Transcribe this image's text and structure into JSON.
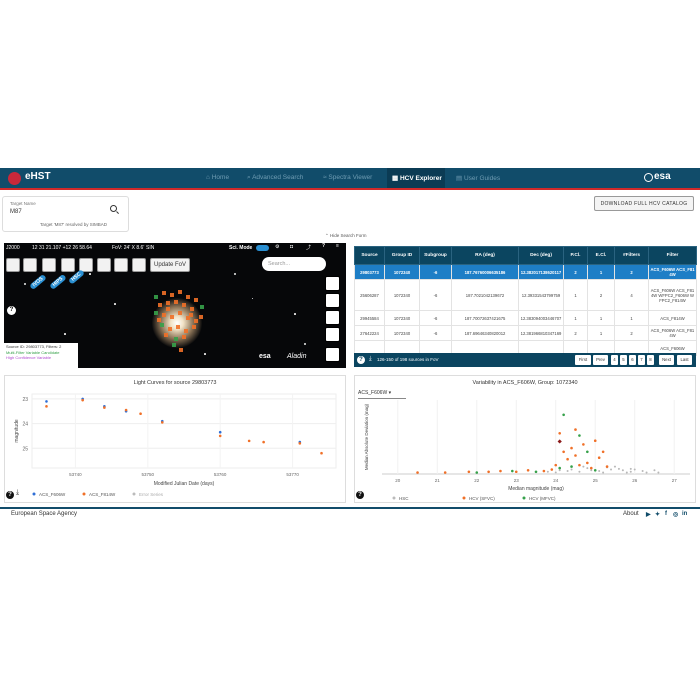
{
  "header": {
    "app_name": "eHST",
    "nav": [
      {
        "label": "Home",
        "icon": "home-icon"
      },
      {
        "label": "Advanced Search",
        "icon": "search-icon"
      },
      {
        "label": "Spectra Viewer",
        "icon": "spectra-icon"
      },
      {
        "label": "HCV Explorer",
        "icon": "grid-icon"
      },
      {
        "label": "User Guides",
        "icon": "doc-icon"
      }
    ],
    "active_nav": "HCV Explorer",
    "brand": "esa",
    "accent_color": "#d12a2a",
    "bar_color": "#114c6a"
  },
  "search": {
    "label": "Target Name",
    "value": "M87",
    "resolved": "Target 'M87' resolved by SIMBAD"
  },
  "download_button": "DOWNLOAD FULL HCV CATALOG",
  "hide_form": "Hide Search Form",
  "sky": {
    "frame": "J2000",
    "coords": "12 31 21.107 +12 26 58.64",
    "fov": "FoV: 24' X 8.6'",
    "projection": "SIN",
    "sci_mode": "Sci. Mode",
    "update_fov": "Update FoV",
    "search_placeholder": "Search...",
    "pills": [
      "IVOS",
      "HIPS",
      "HSC"
    ],
    "source_info": "Source ID: 29803773, Filters: 2",
    "legend_multi": "Multi-Filter Variable Candidate",
    "legend_high": "High Confidence Variable",
    "brand_esa": "esa",
    "brand_aladin": "Aladin"
  },
  "table": {
    "columns": [
      "Source",
      "Group ID",
      "Subgroup",
      "RA (deg)",
      "Dec (deg)",
      "P.Cl.",
      "E.Cl.",
      "#Filters",
      "Filter"
    ],
    "rows": [
      [
        "29803773",
        "1072340",
        "-6",
        "187.76760006635186",
        "12.382017138620117",
        "2",
        "1",
        "2",
        "ACS_F606W ACS_F814W"
      ],
      [
        "25606287",
        "1072340",
        "-6",
        "187.7021042139672",
        "12.39331543799759",
        "1",
        "2",
        "4",
        "ACS_F606W ACS_F814W WFPC2_F606W WFPC2_F814W"
      ],
      [
        "29945584",
        "1072340",
        "-6",
        "187.70072637421675",
        "12.383094003446707",
        "1",
        "1",
        "1",
        "ACS_F814W"
      ],
      [
        "27642224",
        "1072340",
        "-6",
        "187.69646340820012",
        "12.381966810347169",
        "2",
        "1",
        "2",
        "ACS_F606W ACS_F814W"
      ],
      [
        "",
        "",
        "",
        "",
        "",
        "",
        "",
        "",
        "ACS_F606W"
      ]
    ],
    "footer": "126-150 of 198 sources in FoV",
    "pages": [
      "First",
      "Prev",
      "4",
      "5",
      "6",
      "7",
      "8",
      "Next",
      "Last"
    ]
  },
  "lightcurve": {
    "title": "Light Curves for source 29803773",
    "legend": [
      "ACS_F606W",
      "ACS_F814W",
      "Error Series"
    ]
  },
  "variability": {
    "title": "Variability in ACS_F606W, Group: 1072340",
    "filter_select": "ACS_F606W",
    "legend": [
      "HSC",
      "HCV (SFVC)",
      "HCV (MFVC)"
    ]
  },
  "footer": {
    "org": "European Space Agency",
    "about": "About"
  },
  "chart_data": [
    {
      "type": "scatter",
      "title": "Light Curves for source 29803773",
      "xlabel": "Modified Julian Date (days)",
      "ylabel": "magnitude",
      "x_ticks": [
        53740,
        53750,
        53760,
        53770
      ],
      "y_ticks": [
        23,
        24,
        25
      ],
      "ylim": [
        22.8,
        25.8
      ],
      "y_inverted": true,
      "series": [
        {
          "name": "ACS_F606W",
          "color": "#2f6fd6",
          "points": [
            [
              53736,
              23.1
            ],
            [
              53741,
              23.0
            ],
            [
              53744,
              23.3
            ],
            [
              53747,
              23.5
            ],
            [
              53752,
              23.9
            ],
            [
              53760,
              24.35
            ],
            [
              53771,
              24.75
            ]
          ]
        },
        {
          "name": "ACS_F814W",
          "color": "#f07028",
          "points": [
            [
              53736,
              23.3
            ],
            [
              53741,
              23.05
            ],
            [
              53744,
              23.35
            ],
            [
              53747,
              23.45
            ],
            [
              53749,
              23.6
            ],
            [
              53752,
              23.95
            ],
            [
              53760,
              24.5
            ],
            [
              53764,
              24.7
            ],
            [
              53766,
              24.75
            ],
            [
              53771,
              24.8
            ],
            [
              53774,
              25.2
            ]
          ]
        }
      ]
    },
    {
      "type": "scatter",
      "title": "Variability in ACS_F606W, Group: 1072340",
      "xlabel": "Median magnitude (mag)",
      "ylabel": "Median Absolute Deviation (mag)",
      "x_ticks": [
        20,
        21,
        22,
        23,
        24,
        25,
        26,
        27
      ],
      "xlim": [
        19.6,
        27.4
      ],
      "ylim": [
        0,
        1.0
      ],
      "legend_placement": "bottom",
      "series": [
        {
          "name": "HSC",
          "color": "#b8b8b8",
          "points": [
            [
              24.0,
              0.02
            ],
            [
              24.3,
              0.04
            ],
            [
              24.6,
              0.03
            ],
            [
              24.9,
              0.05
            ],
            [
              25.1,
              0.04
            ],
            [
              25.4,
              0.06
            ],
            [
              25.7,
              0.05
            ],
            [
              25.9,
              0.03
            ],
            [
              26.2,
              0.04
            ],
            [
              26.5,
              0.05
            ],
            [
              24.8,
              0.08
            ],
            [
              25.3,
              0.09
            ],
            [
              25.6,
              0.07
            ],
            [
              24.4,
              0.06
            ],
            [
              26.0,
              0.06
            ],
            [
              25.2,
              0.02
            ],
            [
              24.1,
              0.05
            ],
            [
              25.9,
              0.07
            ],
            [
              26.3,
              0.02
            ],
            [
              23.8,
              0.03
            ],
            [
              24.7,
              0.1
            ],
            [
              25.5,
              0.1
            ],
            [
              25.8,
              0.02
            ],
            [
              26.6,
              0.02
            ]
          ]
        },
        {
          "name": "HCV (SFVC)",
          "color": "#f07028",
          "points": [
            [
              20.5,
              0.02
            ],
            [
              21.2,
              0.02
            ],
            [
              21.8,
              0.03
            ],
            [
              22.3,
              0.03
            ],
            [
              22.6,
              0.04
            ],
            [
              23.0,
              0.03
            ],
            [
              23.3,
              0.05
            ],
            [
              23.7,
              0.04
            ],
            [
              23.9,
              0.06
            ],
            [
              24.1,
              0.55
            ],
            [
              24.2,
              0.3
            ],
            [
              24.3,
              0.2
            ],
            [
              24.4,
              0.35
            ],
            [
              24.5,
              0.25
            ],
            [
              24.6,
              0.12
            ],
            [
              24.7,
              0.4
            ],
            [
              24.8,
              0.15
            ],
            [
              24.9,
              0.08
            ],
            [
              25.0,
              0.45
            ],
            [
              25.1,
              0.22
            ],
            [
              25.2,
              0.3
            ],
            [
              25.3,
              0.1
            ],
            [
              24.5,
              0.6
            ],
            [
              24.0,
              0.12
            ]
          ]
        },
        {
          "name": "HCV (MFVC)",
          "color": "#36a14a",
          "points": [
            [
              22.0,
              0.02
            ],
            [
              22.9,
              0.04
            ],
            [
              23.5,
              0.03
            ],
            [
              24.2,
              0.8
            ],
            [
              24.4,
              0.1
            ],
            [
              24.6,
              0.52
            ],
            [
              24.8,
              0.3
            ],
            [
              25.0,
              0.05
            ],
            [
              24.1,
              0.08
            ]
          ]
        },
        {
          "name": "Selected",
          "color": "#8b1a1a",
          "points": [
            [
              24.1,
              0.44
            ]
          ]
        }
      ]
    }
  ]
}
